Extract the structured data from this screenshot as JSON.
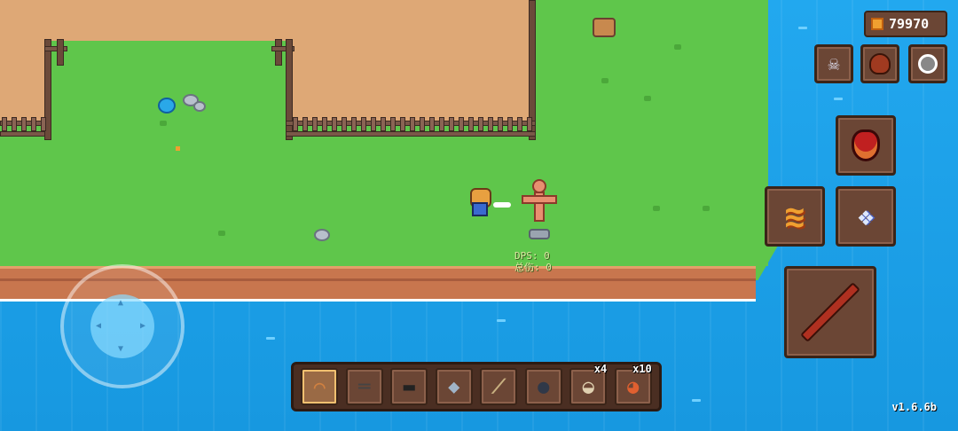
{
  "hud": {
    "coins": "79970",
    "version": "v1.6.6b"
  },
  "dummy_stats": {
    "dps": "DPS: 0",
    "total": "总伤: 0"
  },
  "hotbar": {
    "slots": [
      {
        "icon": "bow-icon",
        "count": "",
        "selected": true
      },
      {
        "icon": "rifle-icon",
        "count": ""
      },
      {
        "icon": "minigun-icon",
        "count": ""
      },
      {
        "icon": "fish-icon",
        "count": ""
      },
      {
        "icon": "sword-icon",
        "count": ""
      },
      {
        "icon": "frying-pan-icon",
        "count": ""
      },
      {
        "icon": "bowl-icon",
        "count": "x4"
      },
      {
        "icon": "pizza-icon",
        "count": "x10"
      }
    ]
  },
  "side_buttons": [
    "ghost-icon",
    "boxing-glove-icon",
    "aim-icon",
    "potion-icon",
    "claw-slash-icon",
    "dash-icon",
    "fishing-rod-icon"
  ],
  "colors": {
    "water": "#1aa3e8",
    "grass": "#5fc64b",
    "dirt": "#dea876",
    "panel": "#6b4635"
  }
}
